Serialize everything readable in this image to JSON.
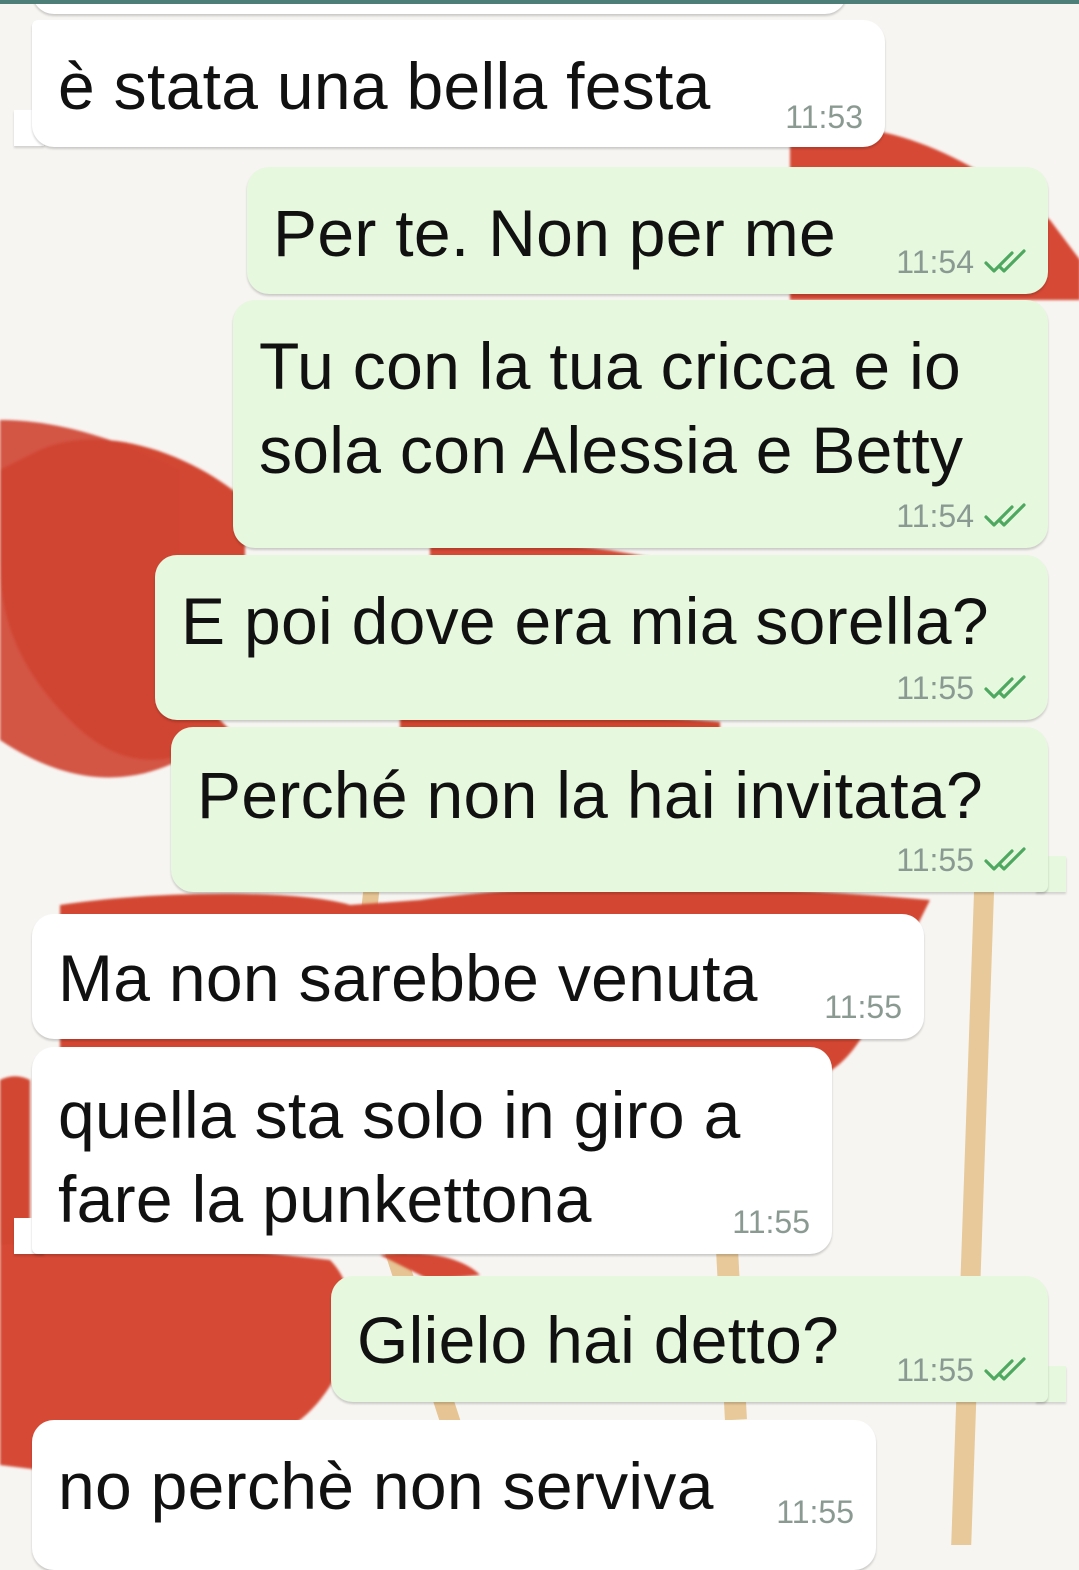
{
  "chat": {
    "messages": [
      {
        "direction": "in",
        "text": "è stata una bella festa",
        "time": "11:53"
      },
      {
        "direction": "out",
        "text": "Per te. Non per me",
        "time": "11:54",
        "status": "read"
      },
      {
        "direction": "out",
        "text": "Tu con la tua cricca e io\nsola con Alessia e Betty",
        "time": "11:54",
        "status": "read"
      },
      {
        "direction": "out",
        "text": "E poi dove era mia sorella?",
        "time": "11:55",
        "status": "read"
      },
      {
        "direction": "out",
        "text": "Perché non la hai invitata?",
        "time": "11:55",
        "status": "read"
      },
      {
        "direction": "in",
        "text": "Ma non sarebbe venuta",
        "time": "11:55"
      },
      {
        "direction": "in",
        "text": "quella sta solo in giro a\nfare la punkettona",
        "time": "11:55"
      },
      {
        "direction": "out",
        "text": "Glielo hai detto?",
        "time": "11:55",
        "status": "read"
      },
      {
        "direction": "in",
        "text": "no perchè non serviva",
        "time": "11:55"
      }
    ]
  },
  "colors": {
    "incoming_bubble": "#ffffff",
    "outgoing_bubble": "#e6f8de",
    "read_ticks": "#34b7f1",
    "timestamp": "#8a9a92",
    "wallpaper_heart": "#d64a36",
    "wallpaper_stick": "#e7c99a"
  },
  "icons": {
    "read_receipt": "double-check-icon"
  }
}
